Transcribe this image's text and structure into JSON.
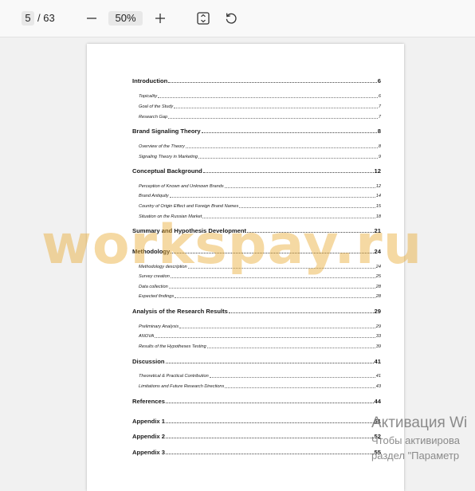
{
  "toolbar": {
    "current_page": "5",
    "total_pages": "/ 63",
    "zoom": "50%",
    "icons": [
      "minus-icon",
      "plus-icon",
      "fit-page-icon",
      "rotate-icon"
    ]
  },
  "toc": [
    {
      "title": "Introduction",
      "page": "6",
      "level": 1
    },
    {
      "title": "Topicality",
      "page": "6",
      "level": 2
    },
    {
      "title": "Goal of the Study",
      "page": "7",
      "level": 2
    },
    {
      "title": "Research Gap",
      "page": "7",
      "level": 2
    },
    {
      "title": "Brand Signaling Theory",
      "page": "8",
      "level": 1
    },
    {
      "title": "Overview of the Theory",
      "page": "8",
      "level": 2
    },
    {
      "title": "Signaling Theory in Marketing",
      "page": "9",
      "level": 2
    },
    {
      "title": "Conceptual Background",
      "page": "12",
      "level": 1
    },
    {
      "title": "Perception of Known and Unknown Brands",
      "page": "12",
      "level": 2
    },
    {
      "title": "Brand Antiquity",
      "page": "14",
      "level": 2
    },
    {
      "title": "Country of Origin Effect and Foreign Brand Names",
      "page": "15",
      "level": 2
    },
    {
      "title": "Situation on the Russian Market",
      "page": "18",
      "level": 2
    },
    {
      "title": "Summary and Hypothesis Development",
      "page": "21",
      "level": 1
    },
    {
      "title": "Methodology",
      "page": "24",
      "level": 1
    },
    {
      "title": "Methodology description",
      "page": "24",
      "level": 2
    },
    {
      "title": "Survey creation",
      "page": "25",
      "level": 2
    },
    {
      "title": "Data collection",
      "page": "28",
      "level": 2
    },
    {
      "title": "Expected findings",
      "page": "28",
      "level": 2
    },
    {
      "title": "Analysis of the Research Results",
      "page": "29",
      "level": 1
    },
    {
      "title": "Preliminary Analysis",
      "page": "29",
      "level": 2
    },
    {
      "title": "ANOVA",
      "page": "33",
      "level": 2
    },
    {
      "title": "Results of the Hypotheses Testing",
      "page": "39",
      "level": 2
    },
    {
      "title": "Discussion",
      "page": "41",
      "level": 1
    },
    {
      "title": "Theoretical & Practical Contribution",
      "page": "41",
      "level": 2
    },
    {
      "title": "Limitations and Future Research Directions",
      "page": "43",
      "level": 2
    },
    {
      "title": "References",
      "page": "44",
      "level": 1
    },
    {
      "title": "Appendix 1",
      "page": "51",
      "level": 1
    },
    {
      "title": "Appendix 2",
      "page": "52",
      "level": 1
    },
    {
      "title": "Appendix 3",
      "page": "55",
      "level": 1
    }
  ],
  "watermark": "workspay.ru",
  "activation": {
    "title": "Активация Wi",
    "line1": "Чтобы активирова",
    "line2": "раздел \"Параметр"
  }
}
